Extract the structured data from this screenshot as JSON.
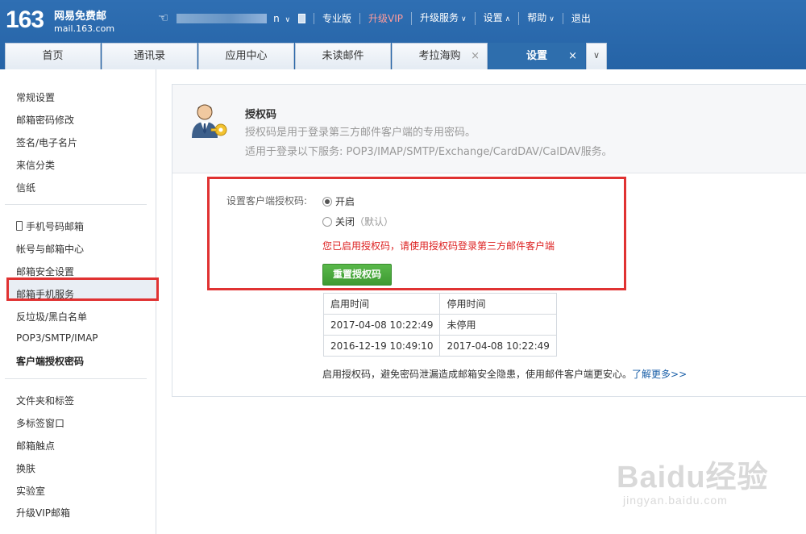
{
  "header": {
    "logo_num": "163",
    "logo_cn": "网易免费邮",
    "logo_url": "mail.163.com",
    "top_links": [
      "专业版",
      "升级VIP",
      "升级服务",
      "设置",
      "帮助",
      "退出"
    ],
    "accent": "#2f6fb3"
  },
  "tabs": [
    {
      "label": "首页"
    },
    {
      "label": "通讯录"
    },
    {
      "label": "应用中心"
    },
    {
      "label": "未读邮件"
    },
    {
      "label": "考拉海购"
    },
    {
      "label": "设置"
    }
  ],
  "sidebar": {
    "group1": [
      "常规设置",
      "邮箱密码修改",
      "签名/电子名片",
      "来信分类",
      "信纸"
    ],
    "group2": [
      "手机号码邮箱",
      "帐号与邮箱中心",
      "邮箱安全设置",
      "邮箱手机服务",
      "反垃圾/黑白名单",
      "POP3/SMTP/IMAP",
      "客户端授权密码"
    ],
    "group3": [
      "文件夹和标签",
      "多标签窗口",
      "邮箱触点",
      "换肤",
      "实验室",
      "升级VIP邮箱"
    ]
  },
  "panel": {
    "title": "授权码",
    "desc1": "授权码是用于登录第三方邮件客户端的专用密码。",
    "desc2": "适用于登录以下服务: POP3/IMAP/SMTP/Exchange/CardDAV/CalDAV服务。",
    "setting_label": "设置客户端授权码:",
    "radio_on": "开启",
    "radio_off": "关闭",
    "radio_off_note": "（默认）",
    "status_msg": "您已启用授权码，请使用授权码登录第三方邮件客户端",
    "reset_button": "重置授权码",
    "table_headers": [
      "启用时间",
      "停用时间"
    ],
    "table_rows": [
      [
        "2017-04-08 10:22:49",
        "未停用"
      ],
      [
        "2016-12-19 10:49:10",
        "2017-04-08 10:22:49"
      ]
    ],
    "note": "启用授权码，避免密码泄漏造成邮箱安全隐患，使用邮件客户端更安心。",
    "learn_more": "了解更多>>"
  },
  "watermark": {
    "main": "Baidu经验",
    "sub": "jingyan.baidu.com"
  }
}
